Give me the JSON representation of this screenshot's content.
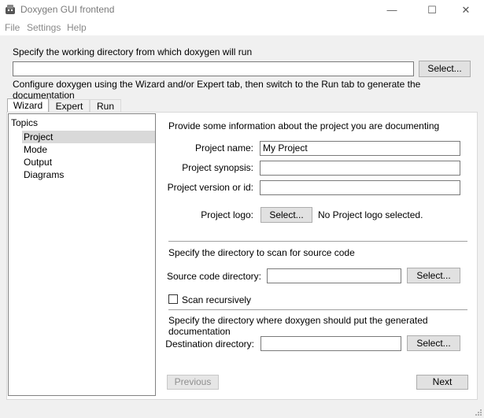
{
  "window": {
    "title": "Doxygen GUI frontend",
    "minimize_glyph": "—",
    "maximize_glyph": "☐",
    "close_glyph": "✕"
  },
  "menu": {
    "items": [
      "File",
      "Settings",
      "Help"
    ]
  },
  "workdir": {
    "prompt": "Specify the working directory from which doxygen will run",
    "value": "",
    "select_label": "Select...",
    "hint": "Configure doxygen using the Wizard and/or Expert tab, then switch to the Run tab to generate the documentation"
  },
  "tabs": [
    "Wizard",
    "Expert",
    "Run"
  ],
  "topics": {
    "header": "Topics",
    "items": [
      "Project",
      "Mode",
      "Output",
      "Diagrams"
    ],
    "selected": "Project"
  },
  "project": {
    "intro": "Provide some information about the project you are documenting",
    "name_label": "Project name:",
    "name_value": "My Project",
    "synopsis_label": "Project synopsis:",
    "synopsis_value": "",
    "version_label": "Project version or id:",
    "version_value": "",
    "logo_label": "Project logo:",
    "logo_button": "Select...",
    "logo_status": "No Project logo selected."
  },
  "source": {
    "heading": "Specify the directory to scan for source code",
    "dir_label": "Source code directory:",
    "dir_value": "",
    "select_label": "Select...",
    "scan_recursively_label": "Scan recursively",
    "scan_recursively_checked": false
  },
  "destination": {
    "heading": "Specify the directory where doxygen should put the generated documentation",
    "dir_label": "Destination directory:",
    "dir_value": "",
    "select_label": "Select..."
  },
  "nav": {
    "previous_label": "Previous",
    "next_label": "Next"
  }
}
